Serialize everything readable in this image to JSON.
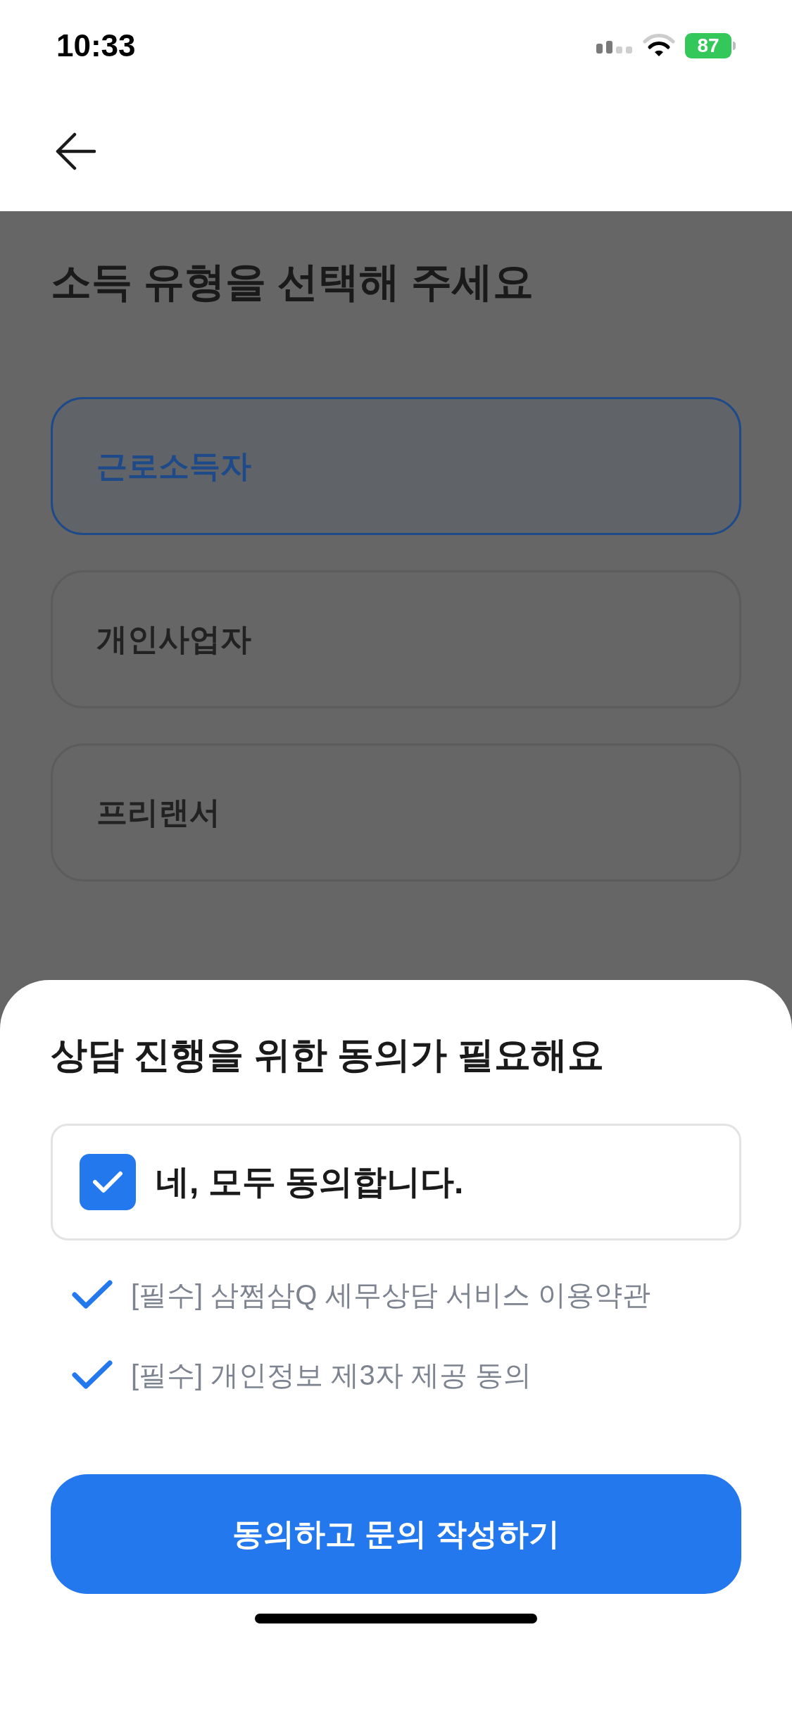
{
  "status_bar": {
    "time": "10:33",
    "battery": "87"
  },
  "page": {
    "title": "소득 유형을 선택해 주세요",
    "options": [
      {
        "label": "근로소득자",
        "selected": true
      },
      {
        "label": "개인사업자",
        "selected": false
      },
      {
        "label": "프리랜서",
        "selected": false
      }
    ]
  },
  "sheet": {
    "title": "상담 진행을 위한 동의가 필요해요",
    "agree_all": {
      "label": "네, 모두 동의합니다.",
      "checked": true
    },
    "terms": [
      {
        "label": "[필수] 삼쩜삼Q 세무상담 서비스 이용약관",
        "checked": true
      },
      {
        "label": "[필수] 개인정보 제3자 제공 동의",
        "checked": true
      }
    ],
    "button": "동의하고 문의 작성하기"
  }
}
